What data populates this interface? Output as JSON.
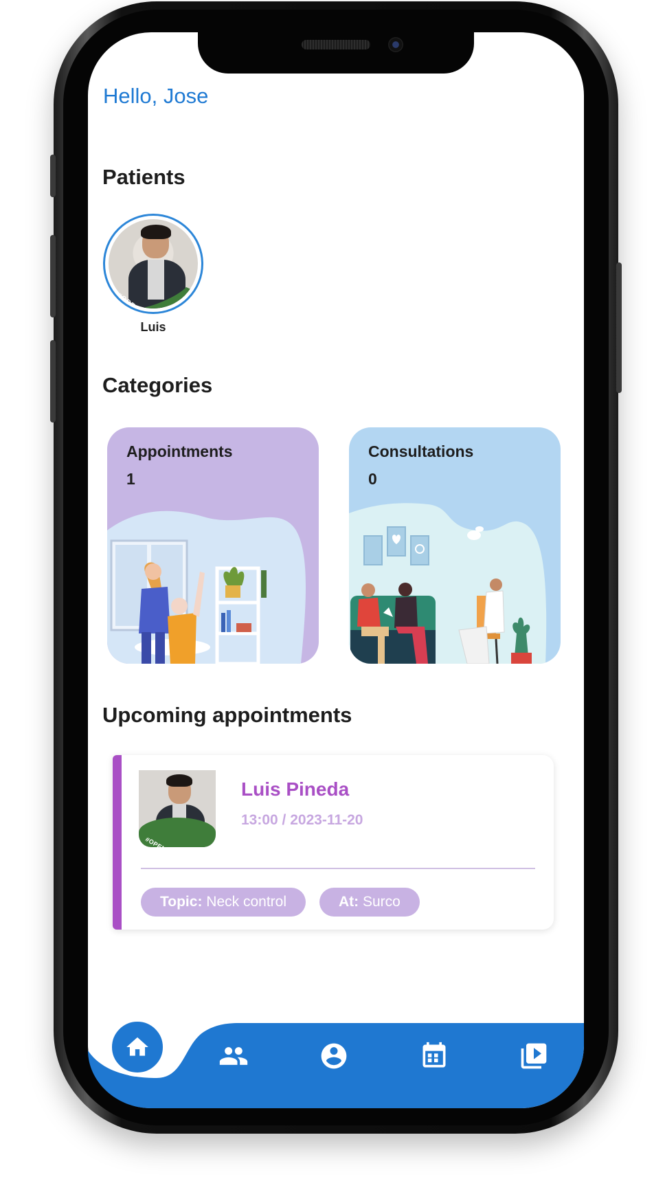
{
  "header": {
    "greeting": "Hello, Jose"
  },
  "patients": {
    "title": "Patients",
    "items": [
      {
        "name": "Luis",
        "badge": "#OPENTOWORK"
      }
    ]
  },
  "categories": {
    "title": "Categories",
    "items": [
      {
        "label": "Appointments",
        "count": "1",
        "color": "#c6b6e4"
      },
      {
        "label": "Consultations",
        "count": "0",
        "color": "#b3d6f2"
      }
    ]
  },
  "upcoming": {
    "title": "Upcoming appointments",
    "appointments": [
      {
        "name": "Luis Pineda",
        "datetime": "13:00 / 2023-11-20",
        "photo_badge": "#OPENTOWORK",
        "topic_label": "Topic:",
        "topic": "Neck control",
        "at_label": "At:",
        "location": "Surco"
      }
    ]
  },
  "bottom_nav": {
    "items": [
      {
        "icon": "home-icon",
        "active": true
      },
      {
        "icon": "people-icon"
      },
      {
        "icon": "account-circle-icon"
      },
      {
        "icon": "calendar-icon"
      },
      {
        "icon": "video-library-icon"
      }
    ],
    "color": "#1f78d1"
  },
  "theme": {
    "accent": "#1f7ad3",
    "appointment_accent": "#a94fc5"
  }
}
